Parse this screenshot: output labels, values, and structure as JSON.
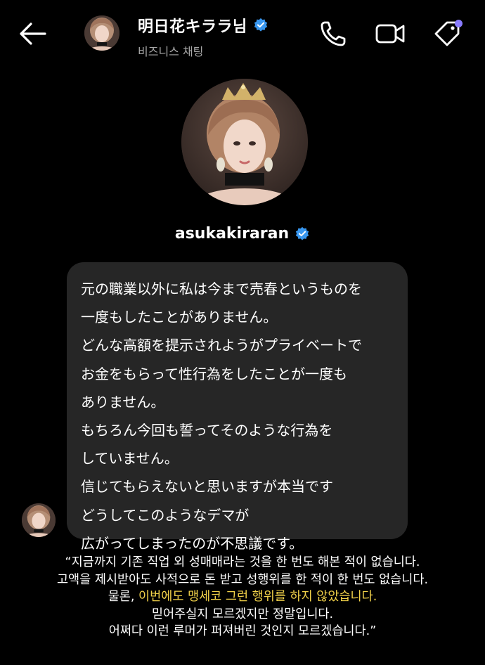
{
  "header": {
    "title": "明日花キララ님",
    "subtitle": "비즈니스 채팅"
  },
  "profile": {
    "username": "asukakiraran"
  },
  "message": {
    "lines": [
      "元の職業以外に私は今まで売春というものを",
      "一度もしたことがありません。",
      "どんな高額を提示されようがプライベートで",
      "お金をもらって性行為をしたことが一度も",
      "ありません。",
      "もちろん今回も誓ってそのような行為を",
      "していません。",
      "信じてもらえないと思いますが本当です",
      "どうしてこのようなデマが",
      "広がってしまったのが不思議です。"
    ]
  },
  "caption": {
    "line1": "“지금까지 기존 직업 외 성매매라는 것을 한 번도 해본 적이 없습니다.",
    "line2": "고액을 제시받아도 사적으로 돈 받고 성행위를 한 적이 한 번도 없습니다.",
    "line3_prefix": "물론, ",
    "line3_highlight": "이번에도 맹세코 그런 행위를 하지 않았습니다.",
    "line4": "믿어주실지 모르겠지만 정말입니다.",
    "line5": "어쩌다 이런 루머가 퍼져버린 것인지 모르겠습니다.”"
  },
  "colors": {
    "background": "#000000",
    "bubble": "#262626",
    "verified": "#3897f0",
    "highlight": "#f2d24a",
    "subtitle": "#a8a8a8",
    "notification_dot": "#8a7cff"
  },
  "icons": {
    "back": "arrow-left-icon",
    "call": "phone-icon",
    "video": "video-camera-icon",
    "tag": "tag-icon",
    "verified": "verified-badge-icon"
  }
}
